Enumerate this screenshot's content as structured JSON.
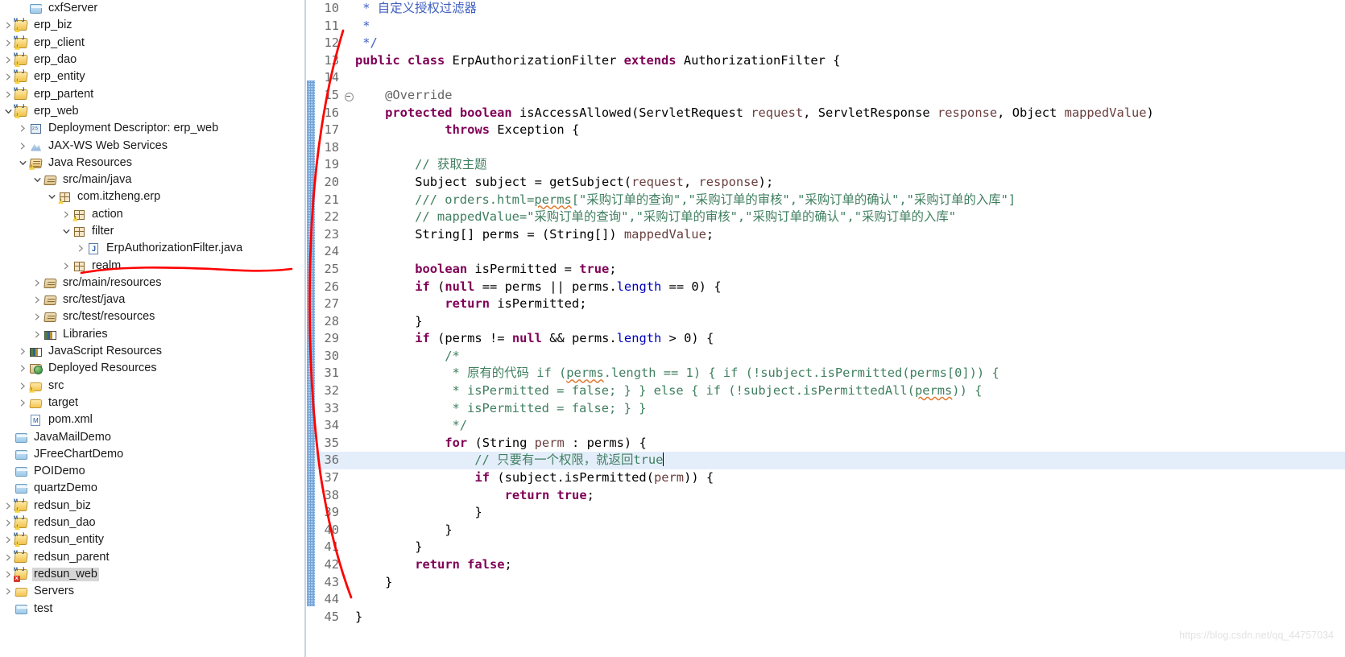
{
  "explorer": {
    "name": "package-explorer",
    "rows": [
      {
        "indent": 1,
        "twisty": "none",
        "icon": "folder-blue",
        "label": "cxfServer",
        "selected": false
      },
      {
        "indent": 0,
        "twisty": "right",
        "icon": "mvn-warn",
        "label": "erp_biz",
        "selected": false
      },
      {
        "indent": 0,
        "twisty": "right",
        "icon": "mvn-warn",
        "label": "erp_client",
        "selected": false
      },
      {
        "indent": 0,
        "twisty": "right",
        "icon": "mvn-warn",
        "label": "erp_dao",
        "selected": false
      },
      {
        "indent": 0,
        "twisty": "right",
        "icon": "mvn-warn",
        "label": "erp_entity",
        "selected": false
      },
      {
        "indent": 0,
        "twisty": "right",
        "icon": "mvn",
        "label": "erp_partent",
        "selected": false
      },
      {
        "indent": 0,
        "twisty": "down",
        "icon": "mvn-warn",
        "label": "erp_web",
        "selected": false
      },
      {
        "indent": 1,
        "twisty": "right",
        "icon": "dep-desc",
        "label": "Deployment Descriptor: erp_web",
        "selected": false
      },
      {
        "indent": 1,
        "twisty": "right",
        "icon": "web-service",
        "label": "JAX-WS Web Services",
        "selected": false
      },
      {
        "indent": 1,
        "twisty": "down",
        "icon": "java-res",
        "label": "Java Resources",
        "selected": false
      },
      {
        "indent": 2,
        "twisty": "down",
        "icon": "src-folder",
        "label": "src/main/java",
        "selected": false
      },
      {
        "indent": 3,
        "twisty": "down",
        "icon": "package-warn",
        "label": "com.itzheng.erp",
        "selected": false
      },
      {
        "indent": 4,
        "twisty": "right",
        "icon": "package-warn",
        "label": "action",
        "selected": false
      },
      {
        "indent": 4,
        "twisty": "down",
        "icon": "package",
        "label": "filter",
        "selected": false
      },
      {
        "indent": 5,
        "twisty": "right",
        "icon": "java-file",
        "label": "ErpAuthorizationFilter.java",
        "selected": false
      },
      {
        "indent": 4,
        "twisty": "right",
        "icon": "package",
        "label": "realm",
        "selected": false
      },
      {
        "indent": 2,
        "twisty": "right",
        "icon": "src-folder",
        "label": "src/main/resources",
        "selected": false
      },
      {
        "indent": 2,
        "twisty": "right",
        "icon": "src-folder",
        "label": "src/test/java",
        "selected": false
      },
      {
        "indent": 2,
        "twisty": "right",
        "icon": "src-folder",
        "label": "src/test/resources",
        "selected": false
      },
      {
        "indent": 2,
        "twisty": "right",
        "icon": "libraries",
        "label": "Libraries",
        "selected": false
      },
      {
        "indent": 1,
        "twisty": "right",
        "icon": "js-res",
        "label": "JavaScript Resources",
        "selected": false
      },
      {
        "indent": 1,
        "twisty": "right",
        "icon": "deployed-res",
        "label": "Deployed Resources",
        "selected": false
      },
      {
        "indent": 1,
        "twisty": "right",
        "icon": "folder-src",
        "label": "src",
        "selected": false
      },
      {
        "indent": 1,
        "twisty": "right",
        "icon": "folder-open",
        "label": "target",
        "selected": false
      },
      {
        "indent": 1,
        "twisty": "none",
        "icon": "xml-file",
        "label": "pom.xml",
        "selected": false
      },
      {
        "indent": 0,
        "twisty": "none",
        "icon": "folder-blue",
        "label": "JavaMailDemo",
        "selected": false
      },
      {
        "indent": 0,
        "twisty": "none",
        "icon": "folder-blue",
        "label": "JFreeChartDemo",
        "selected": false
      },
      {
        "indent": 0,
        "twisty": "none",
        "icon": "folder-blue",
        "label": "POIDemo",
        "selected": false
      },
      {
        "indent": 0,
        "twisty": "none",
        "icon": "folder-blue",
        "label": "quartzDemo",
        "selected": false
      },
      {
        "indent": 0,
        "twisty": "right",
        "icon": "mvn-warn",
        "label": "redsun_biz",
        "selected": false
      },
      {
        "indent": 0,
        "twisty": "right",
        "icon": "mvn-warn",
        "label": "redsun_dao",
        "selected": false
      },
      {
        "indent": 0,
        "twisty": "right",
        "icon": "mvn-warn",
        "label": "redsun_entity",
        "selected": false
      },
      {
        "indent": 0,
        "twisty": "right",
        "icon": "mvn",
        "label": "redsun_parent",
        "selected": false
      },
      {
        "indent": 0,
        "twisty": "right",
        "icon": "mvn-err",
        "label": "redsun_web",
        "selected": true
      },
      {
        "indent": 0,
        "twisty": "right",
        "icon": "folder-open",
        "label": "Servers",
        "selected": false
      },
      {
        "indent": 0,
        "twisty": "none",
        "icon": "folder-blue",
        "label": "test",
        "selected": false
      }
    ]
  },
  "editor": {
    "name": "java-editor",
    "file": "ErpAuthorizationFilter.java",
    "current_line": 36,
    "first_visible_line": 10,
    "last_visible_line": 45,
    "lines": [
      {
        "n": 10,
        "fold": "",
        "current": false,
        "text": " * 自定义授权过滤器"
      },
      {
        "n": 11,
        "fold": "",
        "current": false,
        "text": " *"
      },
      {
        "n": 12,
        "fold": "",
        "current": false,
        "text": " */"
      },
      {
        "n": 13,
        "fold": "",
        "current": false,
        "text": "public class ErpAuthorizationFilter extends AuthorizationFilter {"
      },
      {
        "n": 14,
        "fold": "",
        "current": false,
        "text": ""
      },
      {
        "n": 15,
        "fold": "minus",
        "current": false,
        "text": "    @Override"
      },
      {
        "n": 16,
        "fold": "",
        "current": false,
        "text": "    protected boolean isAccessAllowed(ServletRequest request, ServletResponse response, Object mappedValue)"
      },
      {
        "n": 17,
        "fold": "",
        "current": false,
        "text": "            throws Exception {"
      },
      {
        "n": 18,
        "fold": "",
        "current": false,
        "text": ""
      },
      {
        "n": 19,
        "fold": "",
        "current": false,
        "text": "        // 获取主题"
      },
      {
        "n": 20,
        "fold": "",
        "current": false,
        "text": "        Subject subject = getSubject(request, response);"
      },
      {
        "n": 21,
        "fold": "",
        "current": false,
        "text": "        /// orders.html=perms[\"采购订单的查询\",\"采购订单的审核\",\"采购订单的确认\",\"采购订单的入库\"]"
      },
      {
        "n": 22,
        "fold": "",
        "current": false,
        "text": "        // mappedValue=\"采购订单的查询\",\"采购订单的审核\",\"采购订单的确认\",\"采购订单的入库\""
      },
      {
        "n": 23,
        "fold": "",
        "current": false,
        "text": "        String[] perms = (String[]) mappedValue;"
      },
      {
        "n": 24,
        "fold": "",
        "current": false,
        "text": ""
      },
      {
        "n": 25,
        "fold": "",
        "current": false,
        "text": "        boolean isPermitted = true;"
      },
      {
        "n": 26,
        "fold": "",
        "current": false,
        "text": "        if (null == perms || perms.length == 0) {"
      },
      {
        "n": 27,
        "fold": "",
        "current": false,
        "text": "            return isPermitted;"
      },
      {
        "n": 28,
        "fold": "",
        "current": false,
        "text": "        }"
      },
      {
        "n": 29,
        "fold": "",
        "current": false,
        "text": "        if (perms != null && perms.length > 0) {"
      },
      {
        "n": 30,
        "fold": "",
        "current": false,
        "text": "            /*"
      },
      {
        "n": 31,
        "fold": "",
        "current": false,
        "text": "             * 原有的代码 if (perms.length == 1) { if (!subject.isPermitted(perms[0])) {"
      },
      {
        "n": 32,
        "fold": "",
        "current": false,
        "text": "             * isPermitted = false; } } else { if (!subject.isPermittedAll(perms)) {"
      },
      {
        "n": 33,
        "fold": "",
        "current": false,
        "text": "             * isPermitted = false; } }"
      },
      {
        "n": 34,
        "fold": "",
        "current": false,
        "text": "             */"
      },
      {
        "n": 35,
        "fold": "",
        "current": false,
        "text": "            for (String perm : perms) {"
      },
      {
        "n": 36,
        "fold": "",
        "current": true,
        "text": "                // 只要有一个权限，就返回true"
      },
      {
        "n": 37,
        "fold": "",
        "current": false,
        "text": "                if (subject.isPermitted(perm)) {"
      },
      {
        "n": 38,
        "fold": "",
        "current": false,
        "text": "                    return true;"
      },
      {
        "n": 39,
        "fold": "",
        "current": false,
        "text": "                }"
      },
      {
        "n": 40,
        "fold": "",
        "current": false,
        "text": "            }"
      },
      {
        "n": 41,
        "fold": "",
        "current": false,
        "text": "        }"
      },
      {
        "n": 42,
        "fold": "",
        "current": false,
        "text": "        return false;"
      },
      {
        "n": 43,
        "fold": "",
        "current": false,
        "text": "    }"
      },
      {
        "n": 44,
        "fold": "",
        "current": false,
        "text": ""
      },
      {
        "n": 45,
        "fold": "",
        "current": false,
        "text": "}"
      }
    ]
  },
  "annotation": {
    "name": "red-pen-annotation",
    "color": "#ff0000",
    "description": "hand-drawn red curve from ErpAuthorizationFilter.java in the tree up and down along the editor gutter"
  },
  "watermark": {
    "text": "https://blog.csdn.net/qq_44757034",
    "color": "#e6e6e6"
  }
}
